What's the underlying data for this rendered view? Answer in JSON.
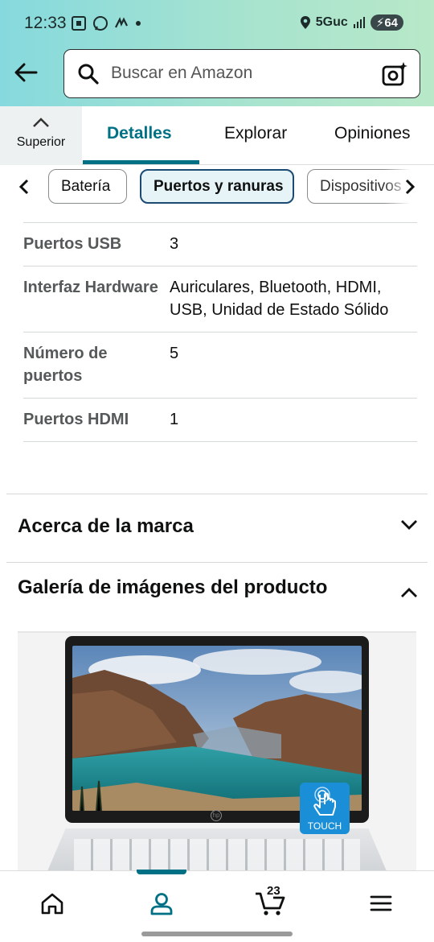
{
  "status_bar": {
    "time": "12:33",
    "network": "5Guc",
    "battery": "64"
  },
  "search": {
    "placeholder": "Buscar en Amazon"
  },
  "tabs": {
    "superior": "Superior",
    "items": [
      "Detalles",
      "Explorar",
      "Opiniones"
    ],
    "active": "Detalles"
  },
  "chips": {
    "items": [
      "Batería",
      "Puertos y ranuras",
      "Dispositivos"
    ],
    "selected": "Puertos y ranuras"
  },
  "specs": [
    {
      "key": "Puertos USB",
      "value": "3"
    },
    {
      "key": "Interfaz Hardware",
      "value": "Auriculares, Bluetooth, HDMI, USB, Unidad de Estado Sólido"
    },
    {
      "key": "Número de puertos",
      "value": "5"
    },
    {
      "key": "Puertos HDMI",
      "value": "1"
    }
  ],
  "sections": {
    "brand": "Acerca de la marca",
    "gallery": "Galería de imágenes del producto"
  },
  "gallery": {
    "badge": "TOUCH"
  },
  "bottom_nav": {
    "items": [
      "home",
      "account",
      "cart",
      "menu"
    ],
    "active": "account",
    "cart_count": "23"
  },
  "colors": {
    "accent": "#007185",
    "chip_selected_border": "#1b4a73",
    "touch_badge": "#1a8fd8"
  }
}
